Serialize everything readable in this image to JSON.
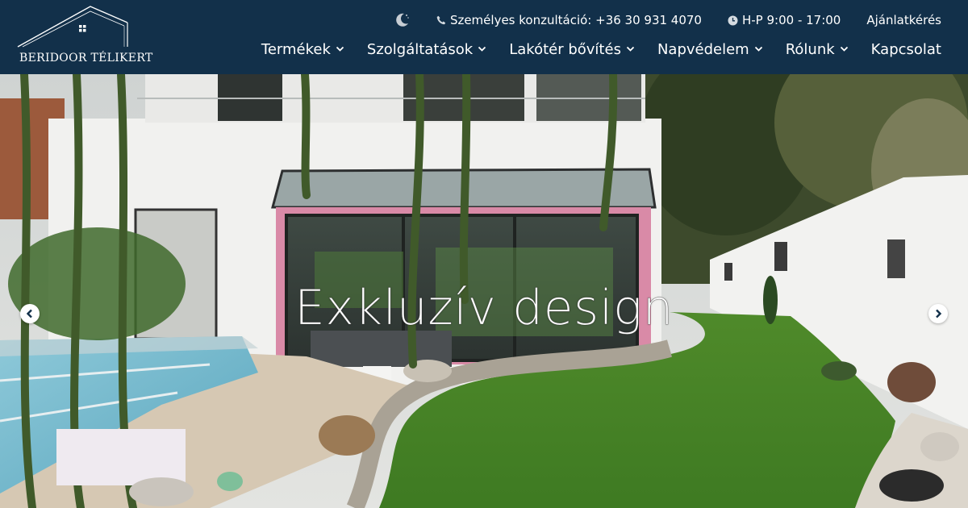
{
  "brand": {
    "logo_text": "BERIDOOR TÉLIKERT"
  },
  "topbar": {
    "theme_icon": "moon-icon",
    "phone_icon": "phone-icon",
    "phone_text": "Személyes konzultáció: +36 30 931 4070",
    "hours_icon": "clock-icon",
    "hours_text": "H-P 9:00 - 17:00",
    "quote_link": "Ajánlatkérés"
  },
  "nav": {
    "items": [
      {
        "label": "Termékek",
        "has_dropdown": true
      },
      {
        "label": "Szolgáltatások",
        "has_dropdown": true
      },
      {
        "label": "Lakótér bővítés",
        "has_dropdown": true
      },
      {
        "label": "Napvédelem",
        "has_dropdown": true
      },
      {
        "label": "Rólunk",
        "has_dropdown": true
      },
      {
        "label": "Kapcsolat",
        "has_dropdown": false
      }
    ]
  },
  "hero": {
    "title": "Exkluzív design",
    "prev_icon": "chevron-left-icon",
    "next_icon": "chevron-right-icon"
  },
  "colors": {
    "header_bg": "#12304a",
    "text": "#ffffff"
  }
}
